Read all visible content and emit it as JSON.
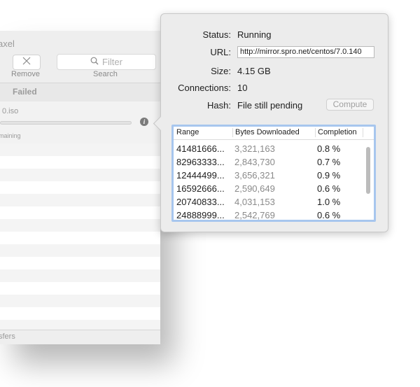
{
  "window": {
    "title": "axel",
    "remove_label": "Remove",
    "search_label": "Search",
    "search_placeholder": "Filter",
    "tab_failed": "Failed",
    "download_name": "0.iso",
    "download_remaining": "maining",
    "footer": "sfers"
  },
  "popover": {
    "status_label": "Status:",
    "status_value": "Running",
    "url_label": "URL:",
    "url_value": "http://mirror.spro.net/centos/7.0.140",
    "size_label": "Size:",
    "size_value": "4.15 GB",
    "connections_label": "Connections:",
    "connections_value": "10",
    "hash_label": "Hash:",
    "hash_value": "File still pending",
    "compute_label": "Compute"
  },
  "table": {
    "headers": [
      "Range",
      "Bytes Downloaded",
      "Completion"
    ],
    "rows": [
      {
        "range": "41481666...",
        "bytes": "3,321,163",
        "completion": "0.8 %"
      },
      {
        "range": "82963333...",
        "bytes": "2,843,730",
        "completion": "0.7 %"
      },
      {
        "range": "12444499...",
        "bytes": "3,656,321",
        "completion": "0.9 %"
      },
      {
        "range": "16592666...",
        "bytes": "2,590,649",
        "completion": "0.6 %"
      },
      {
        "range": "20740833...",
        "bytes": "4,031,153",
        "completion": "1.0 %"
      },
      {
        "range": "24888999...",
        "bytes": "2,542,769",
        "completion": "0.6 %"
      }
    ]
  },
  "icons": {
    "remove": "close-icon",
    "search": "search-icon",
    "info": "info-icon"
  },
  "colors": {
    "table_focus_ring": "#a7c6ee",
    "popover_bg": "#ececec"
  }
}
